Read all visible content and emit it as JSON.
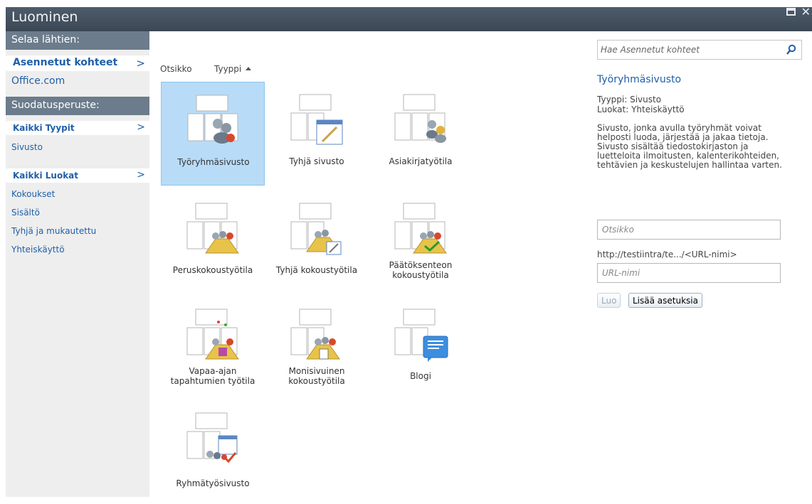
{
  "window": {
    "title": "Luominen",
    "restore_glyph": "▭",
    "close_glyph": "✕"
  },
  "sidebar": {
    "browse_header": "Selaa lähtien:",
    "browse_selected": "Asennetut kohteet",
    "browse_link": "Office.com",
    "filter_header": "Suodatusperuste:",
    "types_selected": "Kaikki Tyypit",
    "types_links": [
      "Sivusto"
    ],
    "categories_selected": "Kaikki Luokat",
    "category_links": [
      "Kokoukset",
      "Sisältö",
      "Tyhjä ja mukautettu",
      "Yhteiskäyttö"
    ],
    "chevron": ">"
  },
  "sort": {
    "title_label": "Otsikko",
    "type_label": "Tyyppi"
  },
  "templates": [
    {
      "label": "Työryhmäsivusto",
      "selected": true
    },
    {
      "label": "Tyhjä sivusto"
    },
    {
      "label": "Asiakirjatyötila"
    },
    {
      "label": "Peruskokoustyötila"
    },
    {
      "label": "Tyhjä kokoustyötila"
    },
    {
      "label_line1": "Päätöksenteon",
      "label_line2": "kokoustyötila"
    },
    {
      "label_line1": "Vapaa-ajan",
      "label_line2": "tapahtumien työtila"
    },
    {
      "label_line1": "Monisivuinen",
      "label_line2": "kokoustyötila"
    },
    {
      "label": "Blogi"
    },
    {
      "label": "Ryhmätyösivusto"
    }
  ],
  "details": {
    "search_placeholder": "Hae Asennetut kohteet",
    "title": "Työryhmäsivusto",
    "type_line": "Tyyppi: Sivusto",
    "category_line": "Luokat: Yhteiskäyttö",
    "description": "Sivusto, jonka avulla työryhmät voivat helposti luoda, järjestää ja jakaa tietoja. Sivusto sisältää tiedostokirjaston ja luetteloita ilmoitusten, kalenterikohteiden, tehtävien ja keskustelujen hallintaa varten.",
    "title_placeholder": "Otsikko",
    "url_prefix": "http://testiintra/te.../<URL-nimi>",
    "url_placeholder": "URL-nimi",
    "create_label": "Luo",
    "more_options_label": "Lisää asetuksia"
  },
  "colors": {
    "accent": "#1f5fa8",
    "titlebar": "#3f4b58",
    "sidebar_header": "#6c7c8c",
    "selected_tile": "#b8dcf7"
  }
}
